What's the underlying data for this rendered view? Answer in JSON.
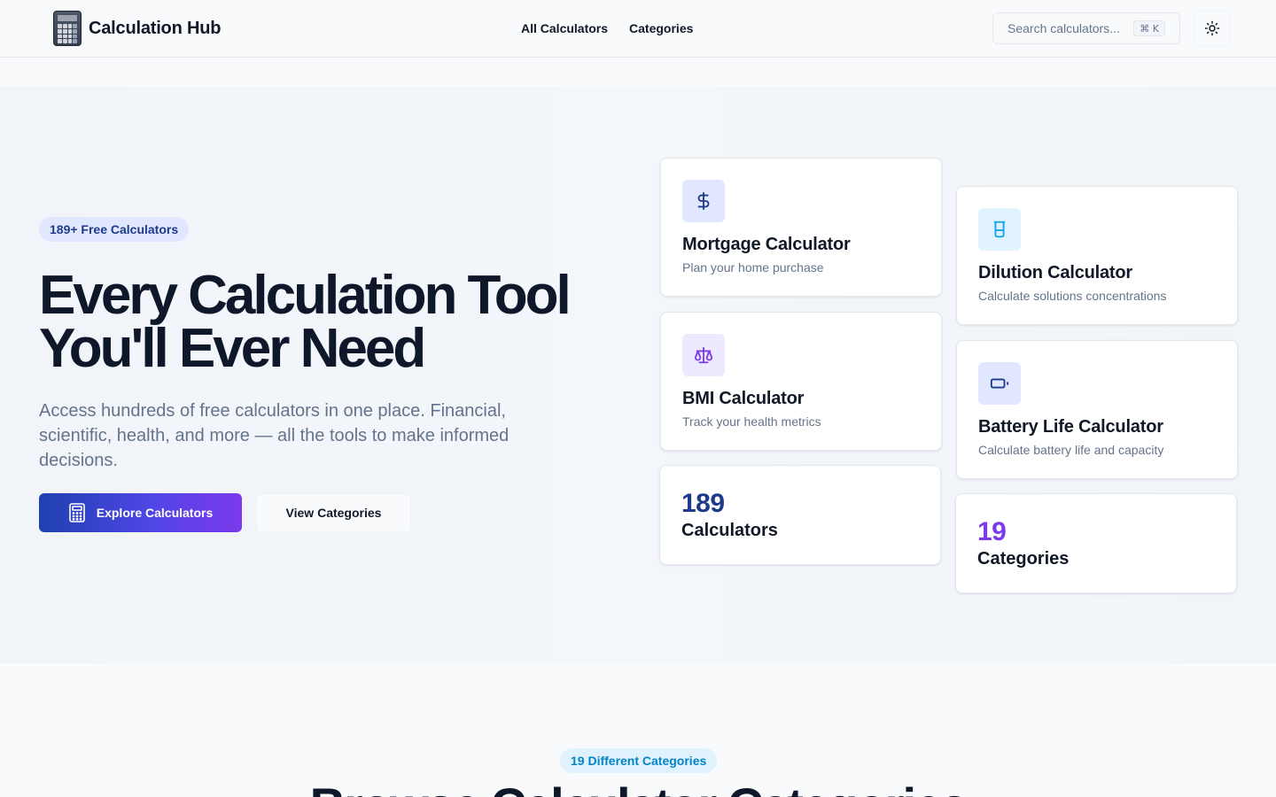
{
  "header": {
    "brand_name": "Calculation Hub",
    "nav": [
      {
        "label": "All Calculators"
      },
      {
        "label": "Categories"
      }
    ],
    "search": {
      "placeholder": "Search calculators...",
      "shortcut": "⌘ K"
    },
    "theme_toggle_icon": "sun-icon"
  },
  "hero": {
    "badge": "189+ Free Calculators",
    "title_line1": "Every Calculation Tool",
    "title_line2": "You'll Ever Need",
    "description": "Access hundreds of free calculators in one place. Financial, scientific, health, and more — all the tools to make informed decisions.",
    "primary_button": "Explore Calculators",
    "secondary_button": "View Categories"
  },
  "cards": {
    "mortgage": {
      "title": "Mortgage Calculator",
      "subtitle": "Plan your home purchase",
      "icon": "dollar-icon"
    },
    "dilution": {
      "title": "Dilution Calculator",
      "subtitle": "Calculate solutions concentrations",
      "icon": "beaker-icon"
    },
    "bmi": {
      "title": "BMI Calculator",
      "subtitle": "Track your health metrics",
      "icon": "scale-icon"
    },
    "battery": {
      "title": "Battery Life Calculator",
      "subtitle": "Calculate battery life and capacity",
      "icon": "battery-icon"
    }
  },
  "stats": {
    "calculators": {
      "value": "189",
      "label": "Calculators"
    },
    "categories": {
      "value": "19",
      "label": "Categories"
    }
  },
  "categories_section": {
    "badge": "19 Different Categories",
    "title": "Browse Calculator Categories"
  },
  "colors": {
    "primary": "#1e40af",
    "accent_purple": "#7c3aed",
    "accent_sky": "#0284c7",
    "text_dark": "#0f172a",
    "text_muted": "#64748b"
  }
}
